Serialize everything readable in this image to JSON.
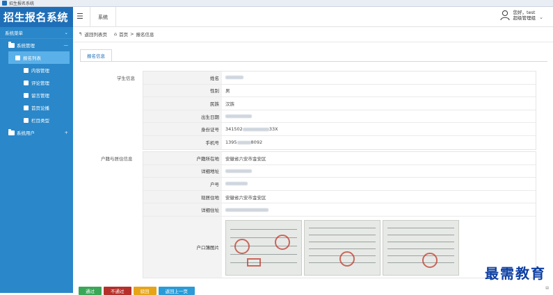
{
  "window": {
    "title": "招生报名系统"
  },
  "header": {
    "logo": "招生报名系统",
    "tab": "系统",
    "user_line1": "您好，test",
    "user_line2": "超级管理组"
  },
  "sidebar": {
    "title": "系统菜单",
    "group1": "系统管理",
    "items": [
      {
        "label": "报名列表",
        "active": true
      },
      {
        "label": "内容管理"
      },
      {
        "label": "评论管理"
      },
      {
        "label": "留言管理"
      },
      {
        "label": "首页论播"
      },
      {
        "label": "栏目类型"
      }
    ],
    "group2": "系统用户"
  },
  "breadcrumb": {
    "back": "返回列表页",
    "home": "首页",
    "sep": ">",
    "current": "报名信息"
  },
  "tab": "报名信息",
  "student": {
    "section": "学生信息",
    "rows": [
      {
        "label": "姓名",
        "value": ""
      },
      {
        "label": "性别",
        "value": "男"
      },
      {
        "label": "民族",
        "value": "汉族"
      },
      {
        "label": "出生日期",
        "value": ""
      },
      {
        "label": "身份证号",
        "value": "341502",
        "suffix": "33X"
      },
      {
        "label": "手机号",
        "value": "1395",
        "suffix": "8092"
      }
    ]
  },
  "residence": {
    "section": "户籍与居住信息",
    "rows": [
      {
        "label": "户籍所在地",
        "value": "安徽省六安市金安区"
      },
      {
        "label": "详细地址",
        "value": ""
      },
      {
        "label": "户号",
        "value": ""
      },
      {
        "label": "现居住地",
        "value": "安徽省六安市金安区"
      },
      {
        "label": "详细住址",
        "value": ""
      }
    ],
    "photo_label": "户口簿图片"
  },
  "buttons": [
    {
      "label": "通过",
      "color": "#3aa657"
    },
    {
      "label": "不通过",
      "color": "#b5302b"
    },
    {
      "label": "驳回",
      "color": "#e6a418"
    },
    {
      "label": "返回上一页",
      "color": "#2a9bd6"
    }
  ],
  "watermark": "最需教育",
  "colors": {
    "brand": "#1e6fb8",
    "sidebar": "#2a87c9",
    "active": "#5ab0e8"
  }
}
